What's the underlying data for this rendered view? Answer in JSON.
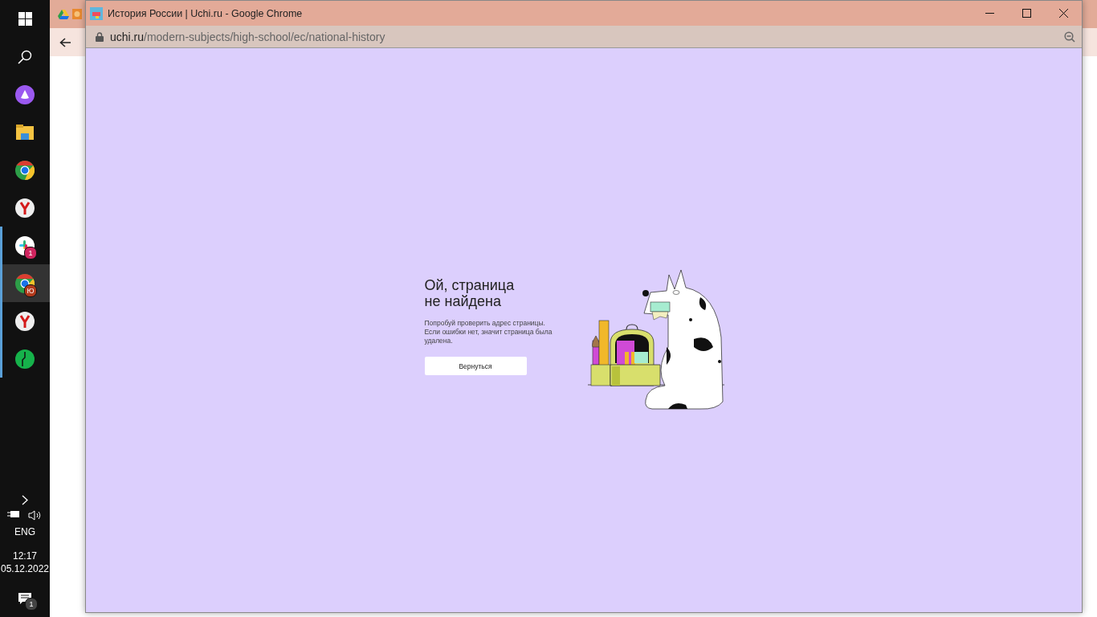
{
  "taskbar": {
    "apps": [
      {
        "kind": "alice",
        "running": false,
        "active": false
      },
      {
        "kind": "explorer",
        "running": false,
        "active": false
      },
      {
        "kind": "chrome",
        "running": false,
        "active": false
      },
      {
        "kind": "yandex",
        "running": false,
        "active": false
      },
      {
        "kind": "slack",
        "running": true,
        "active": false,
        "badge": "1"
      },
      {
        "kind": "chrome",
        "running": true,
        "active": true,
        "badge": "Ю"
      },
      {
        "kind": "yandex",
        "running": true,
        "active": false
      },
      {
        "kind": "megafon",
        "running": true,
        "active": false
      }
    ],
    "tray": {
      "language": "ENG",
      "time": "12:17",
      "date": "05.12.2022",
      "notifications": "1"
    }
  },
  "popup": {
    "title": "История России | Uchi.ru - Google Chrome",
    "url_host": "uchi.ru",
    "url_path": "/modern-subjects/high-school/ec/national-history",
    "page": {
      "heading": [
        "Ой, страница",
        "не найдена"
      ],
      "text": "Попробуй проверить адрес страницы. Если ошибки нет, значит страница была удалена.",
      "button": "Вернуться"
    }
  }
}
